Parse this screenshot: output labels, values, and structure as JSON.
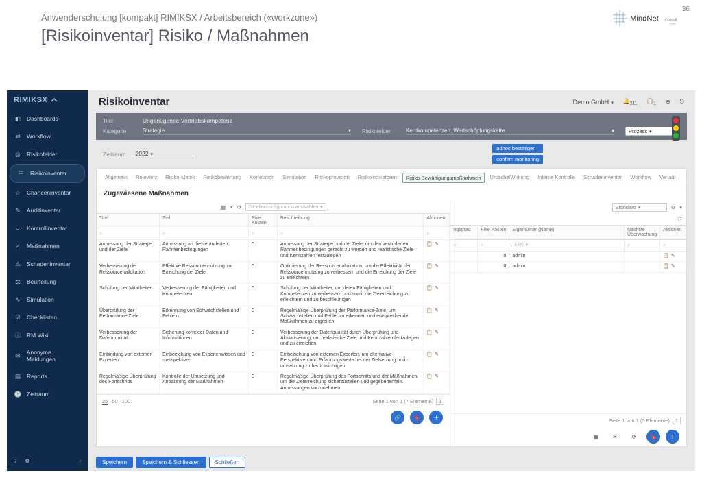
{
  "slide": {
    "page_number": "36",
    "subtitle": "Anwenderschulung [kompakt] RIMIKSX / Arbeitsbereich («workzone»)",
    "title": "[Risikoinventar] Risiko / Maßnahmen",
    "brand": "MindNet",
    "brand_suffix": "Consult"
  },
  "sidebar": {
    "logo": "RIMIKSX",
    "items": [
      {
        "icon": "dashboard",
        "label": "Dashboards"
      },
      {
        "icon": "workflow",
        "label": "Workflow"
      },
      {
        "icon": "risk",
        "label": "Risikofelder"
      },
      {
        "icon": "inventory",
        "label": "Risikoinventar",
        "active": true
      },
      {
        "icon": "chance",
        "label": "Chanceninventar"
      },
      {
        "icon": "audit",
        "label": "Auditinventar"
      },
      {
        "icon": "control",
        "label": "Kontrollinventar"
      },
      {
        "icon": "measures",
        "label": "Maßnahmen"
      },
      {
        "icon": "damage",
        "label": "Schadeninventar"
      },
      {
        "icon": "assess",
        "label": "Beurteilung"
      },
      {
        "icon": "sim",
        "label": "Simulation"
      },
      {
        "icon": "check",
        "label": "Checklisten"
      },
      {
        "icon": "wiki",
        "label": "RM Wiki"
      },
      {
        "icon": "anon",
        "label": "Anonyme Meldungen"
      },
      {
        "icon": "reports",
        "label": "Reports"
      },
      {
        "icon": "period",
        "label": "Zeitraum"
      }
    ]
  },
  "topbar": {
    "title": "Risikoinventar",
    "company": "Demo GmbH",
    "bell_count": "211",
    "clipboard_count": "1"
  },
  "grey": {
    "title_label": "Titel",
    "title_value": "Ungenügende Vertriebskompetenz",
    "category_label": "Kategorie",
    "category_value": "Strategie",
    "riskfield_label": "Risikofelder",
    "riskfield_value": "Kernkompetenzen, Wertschöpfungskette",
    "process_label": "Prozess"
  },
  "filter": {
    "period_label": "Zeitraum",
    "period_value": "2022",
    "btn1": "adhoc bestätigen",
    "btn2": "confirm monitoring"
  },
  "tabs": [
    "Allgemein",
    "Relevanz",
    "Risiko-Matrix",
    "Risikobewertung",
    "Korrelation",
    "Simulation",
    "Risikoprovision",
    "Risikoindikatoren",
    "Risiko-Bewältigungsmaßnahmen",
    "Ursache/Wirkung",
    "Interne Kontrolle",
    "Schadeninventar",
    "Workflow",
    "Verlauf"
  ],
  "tab_active_index": 8,
  "section_title": "Zugewiesene Maßnahmen",
  "left_table": {
    "toolbar_select": "Tabellenkonfiguration auswählen",
    "headers": [
      "Titel",
      "Ziel",
      "Fixe Kosten",
      "Beschreibung",
      "Aktionen"
    ],
    "rows": [
      {
        "t": "Anpassung der Strategie und der Ziele",
        "z": "Anpassung an die veränderten Rahmenbedingungen",
        "k": "0",
        "b": "Anpassung der Strategie und der Ziele, um den veränderten Rahmenbedingungen gerecht zu werden und realistische Ziele und Kennzahlen festzulegen"
      },
      {
        "t": "Verbesserung der Ressourcenallokation",
        "z": "Effektive Ressourcennutzung zur Erreichung der Ziele",
        "k": "0",
        "b": "Optimierung der Ressourcenallokation, um die Effektivität der Ressourcennutzung zu verbessern und die Erreichung der Ziele zu erleichtern"
      },
      {
        "t": "Schulung der Mitarbeiter",
        "z": "Verbesserung der Fähigkeiten und Kompetenzen",
        "k": "0",
        "b": "Schulung der Mitarbeiter, um deren Fähigkeiten und Kompetenzen zu verbessern und somit die Zielerreichung zu erleichtern und zu beschleunigen"
      },
      {
        "t": "Überprüfung der Performance-Ziele",
        "z": "Erkennung von Schwachstellen und Fehlern",
        "k": "0",
        "b": "Regelmäßige Überprüfung der Performance-Ziele, um Schwachstellen und Fehler zu erkennen und entsprechende Maßnahmen zu ergreifen"
      },
      {
        "t": "Verbesserung der Datenqualität",
        "z": "Sicherung korrekter Daten und Informationen",
        "k": "0",
        "b": "Verbesserung der Datenqualität durch Überprüfung und Aktualisierung, um realistische Ziele und Kennzahlen festzulegen und zu erreichen"
      },
      {
        "t": "Einbindung von externen Experten",
        "z": "Einbeziehung von Expertenwissen und -perspektiven",
        "k": "0",
        "b": "Einbeziehung von externen Experten, um alternative Perspektiven und Erfahrungswerte bei der Zielsetzung und -umsetzung zu berücksichtigen"
      },
      {
        "t": "Regelmäßige Überprüfung des Fortschritts",
        "z": "Kontrolle der Umsetzung und Anpassung der Maßnahmen",
        "k": "0",
        "b": "Regelmäßige Überprüfung des Fortschritts und der Maßnahmen, um die Zielerreichung sicherzustellen und gegebenenfalls Anpassungen vorzunehmen"
      }
    ],
    "page_sizes": [
      "25",
      "50",
      "100"
    ],
    "pager_text": "Seite 1 von 1 (7 Elemente)",
    "pager_page": "1"
  },
  "right_table": {
    "standard": "Standard",
    "headers": [
      "ngsgrad",
      "Fixe Kosten",
      "Eigentümer (Name)",
      "Nächste Überwachung",
      "Aktionen"
    ],
    "filter_owner_placeholder": "(Alle)",
    "rows": [
      {
        "k": "0",
        "owner": "admin"
      },
      {
        "k": "0",
        "owner": "admin"
      }
    ],
    "pager_text": "Seite 1 von 1 (2 Elemente)",
    "pager_page": "1"
  },
  "save": {
    "save": "Speichern",
    "save_close": "Speichern & Schliessen",
    "close": "Schließen"
  }
}
